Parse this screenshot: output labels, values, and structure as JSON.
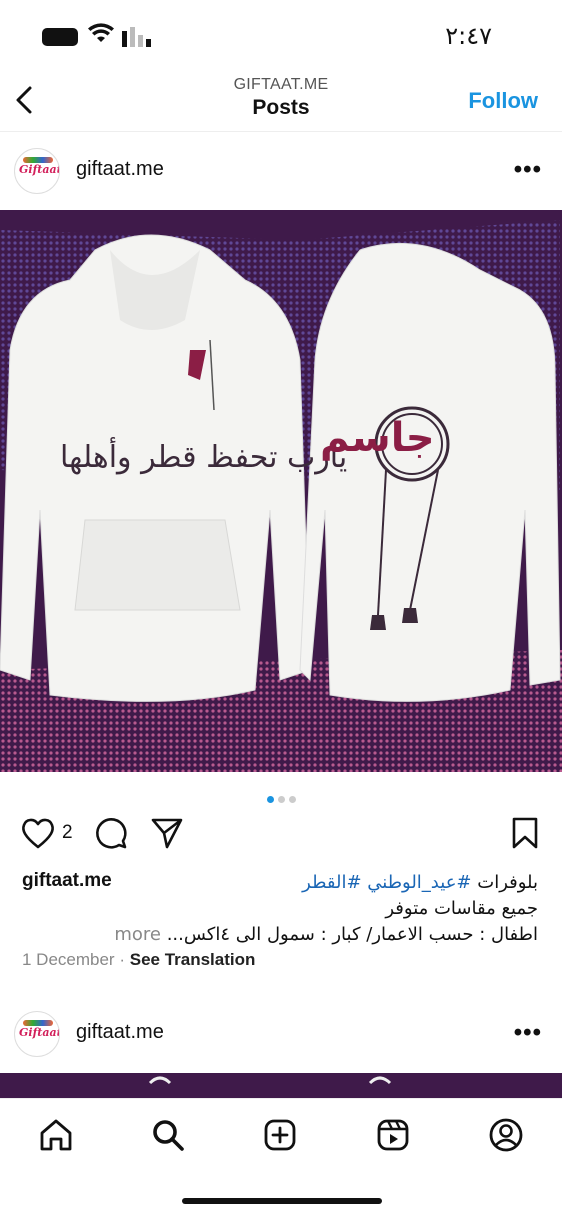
{
  "status_bar": {
    "time": "٢:٤٧"
  },
  "header": {
    "account_label": "GIFTAAT.ME",
    "title": "Posts",
    "follow_label": "Follow"
  },
  "post": {
    "username": "giftaat.me",
    "avatar_text": "Giftaat",
    "image": {
      "left_hoodie_text": "يارب تحفظ قطر وأهلها",
      "right_hoodie_text": "جاسم"
    },
    "carousel": {
      "count": 3,
      "active_index": 0
    },
    "likes_count": "2",
    "caption": {
      "line1_prefix": "بلوفرات",
      "hashtag1": "#عيد_الوطني",
      "hashtag2": "#القطر",
      "line2": "جميع مقاسات متوفر",
      "line3": "اطفال : حسب الاعمار/ كبار : سمول الى ٤اكس...",
      "more_label": "more"
    },
    "date": "1 December",
    "see_translation": "See Translation"
  },
  "post2": {
    "username": "giftaat.me",
    "avatar_text": "Giftaat"
  },
  "nav": {
    "items": [
      "home-icon",
      "search-icon",
      "create-icon",
      "reels-icon",
      "profile-icon"
    ]
  },
  "colors": {
    "accent": "#1a94e0",
    "hashtag": "#1a66b5",
    "background_maroon": "#3f1a4a"
  }
}
